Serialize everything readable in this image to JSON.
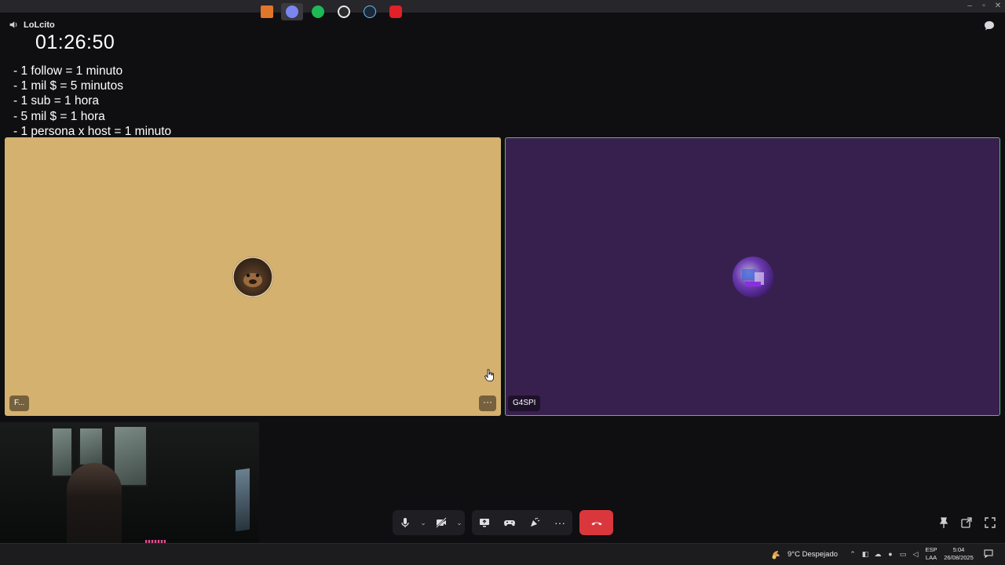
{
  "channel": {
    "name": "LoLcito",
    "icon": "speaker-icon"
  },
  "timer": "01:26:50",
  "rules": [
    "- 1 follow = 1 minuto",
    "- 1 mil $ = 5 minutos",
    "- 1 sub = 1 hora",
    "- 5 mil $ = 1 hora",
    "- 1 persona x host = 1 minuto"
  ],
  "tiles": {
    "left": {
      "name_tag": "F...",
      "more_label": "···",
      "bg_color": "#d5b16f"
    },
    "right": {
      "name_tag": "G4SPI",
      "bg_color": "#38204e",
      "speaking_border": "#47c07a"
    }
  },
  "controls": {
    "mic": "microphone-icon",
    "camera": "camera-off-icon",
    "screen_share": "screen-share-icon",
    "activities": "gamepad-icon",
    "soundboard": "soundboard-icon",
    "more": "···",
    "hangup": "hangup-icon",
    "hangup_color": "#da373c"
  },
  "taskbar": {
    "apps": [
      "tool-icon",
      "discord-icon",
      "spotify-icon",
      "browser-icon",
      "steam-icon",
      "app-icon"
    ],
    "weather": "9°C  Despejado",
    "lang_top": "ESP",
    "lang_bottom": "LAA",
    "time": "5:04",
    "date": "26/08/2025"
  }
}
